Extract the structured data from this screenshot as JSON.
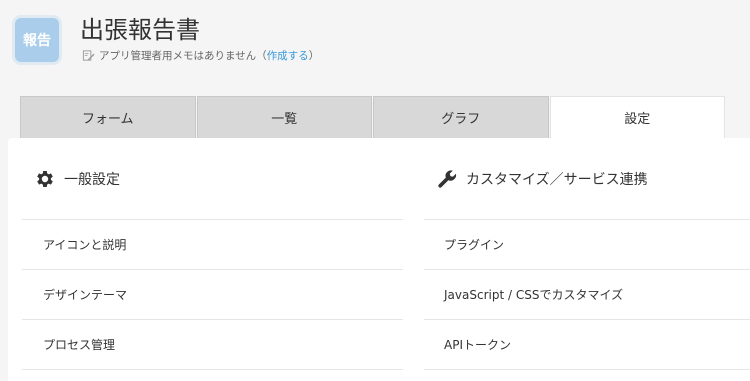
{
  "app": {
    "icon_text": "報告",
    "title": "出張報告書",
    "memo_text": "アプリ管理者用メモはありません（",
    "memo_link": "作成する",
    "memo_close": "）"
  },
  "tabs": [
    {
      "label": "フォーム"
    },
    {
      "label": "一覧"
    },
    {
      "label": "グラフ"
    },
    {
      "label": "設定",
      "active": true
    }
  ],
  "sections": {
    "general": {
      "icon": "gear-icon",
      "title": "一般設定",
      "items": [
        {
          "label": "アイコンと説明"
        },
        {
          "label": "デザインテーマ"
        },
        {
          "label": "プロセス管理"
        }
      ]
    },
    "customize": {
      "icon": "wrench-icon",
      "title": "カスタマイズ／サービス連携",
      "items": [
        {
          "label": "プラグイン"
        },
        {
          "label": "JavaScript / CSSでカスタマイズ"
        },
        {
          "label": "APIトークン"
        }
      ]
    }
  },
  "colors": {
    "accent_link": "#3498db",
    "app_icon_bg": "#a9cdea",
    "tab_inactive": "#d8d8d8",
    "tab_active": "#ffffff"
  }
}
